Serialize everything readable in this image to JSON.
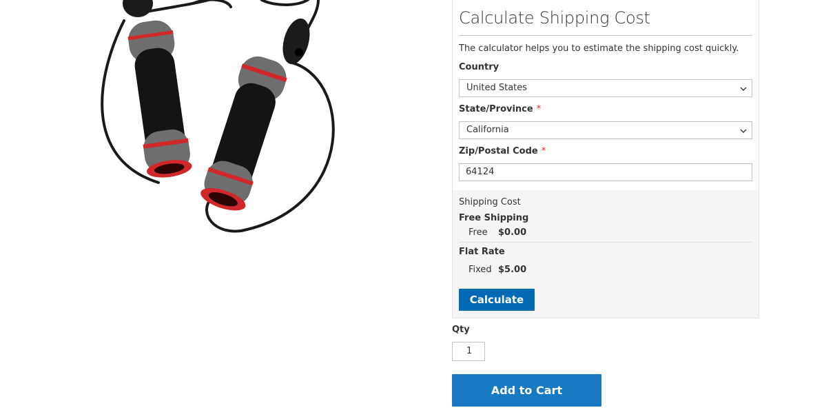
{
  "shipping": {
    "title": "Calculate Shipping Cost",
    "description": "The calculator helps you to estimate the shipping cost quickly.",
    "country_label": "Country",
    "country_value": "United States",
    "state_label": "State/Province",
    "state_value": "California",
    "zip_label": "Zip/Postal Code",
    "zip_value": "64124",
    "required_marker": "*",
    "results_title": "Shipping Cost",
    "methods": [
      {
        "name": "Free Shipping",
        "label": "Free",
        "price": "$0.00"
      },
      {
        "name": "Flat Rate",
        "label": "Fixed",
        "price": "$5.00"
      }
    ],
    "calculate_label": "Calculate"
  },
  "product": {
    "qty_label": "Qty",
    "qty_value": "1",
    "add_to_cart_label": "Add to Cart",
    "image_icon": "jump-rope-image"
  },
  "colors": {
    "primary_button": "#006bb4",
    "cart_button": "#1979c3",
    "required": "#e02b27"
  }
}
